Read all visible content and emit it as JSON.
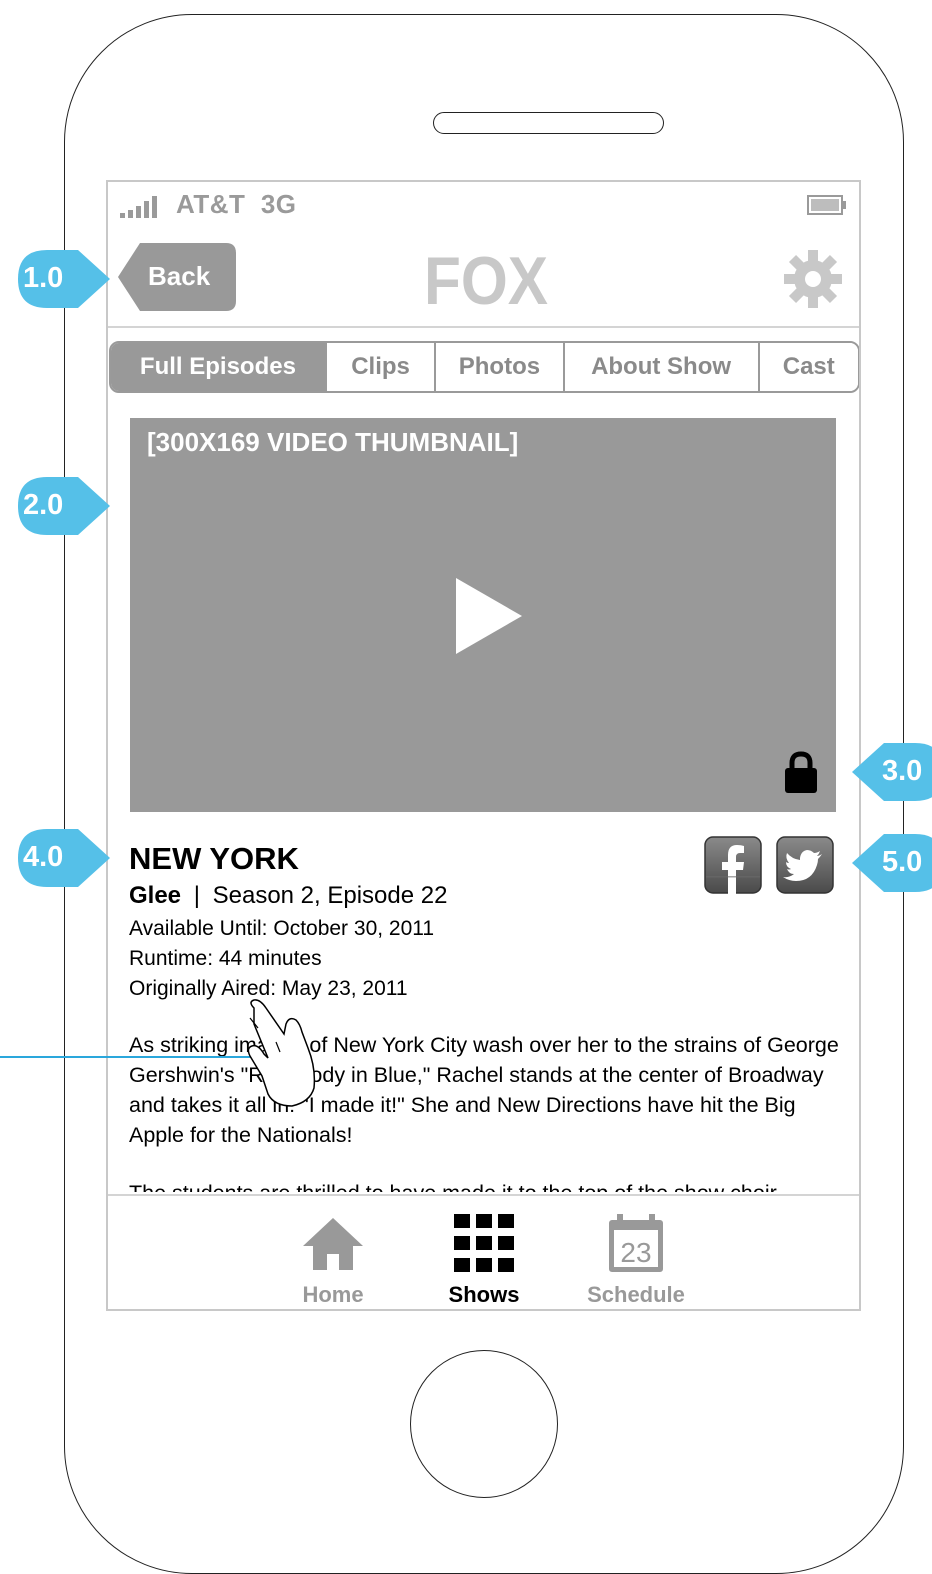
{
  "status_bar": {
    "carrier": "AT&T",
    "network": "3G"
  },
  "nav": {
    "back_label": "Back",
    "logo_text": "FOX"
  },
  "tabs": [
    {
      "label": "Full Episodes",
      "active": true
    },
    {
      "label": "Clips",
      "active": false
    },
    {
      "label": "Photos",
      "active": false
    },
    {
      "label": "About Show",
      "active": false
    },
    {
      "label": "Cast",
      "active": false
    }
  ],
  "video": {
    "placeholder": "[300X169 VIDEO THUMBNAIL]"
  },
  "episode": {
    "title": "NEW YORK",
    "show": "Glee",
    "separator": "|",
    "season_episode": "Season 2, Episode 22",
    "available_until": "Available Until: October 30, 2011",
    "runtime": "Runtime: 44 minutes",
    "originally_aired": "Originally Aired: May 23, 2011",
    "description": [
      "As striking images of New York City wash over her to the strains of George Gershwin's \"Rhapsody in Blue,\" Rachel stands at the center of Broadway and takes it all in: \"I made it!\" She and New Directions have hit the Big Apple for the Nationals!",
      "The students are thrilled to have made it to the top of the show choir"
    ]
  },
  "social": {
    "facebook": "facebook-icon",
    "twitter": "twitter-icon"
  },
  "tabbar": [
    {
      "label": "Home",
      "icon": "home-icon",
      "active": false
    },
    {
      "label": "Shows",
      "icon": "grid-icon",
      "active": true
    },
    {
      "label": "Schedule",
      "icon": "calendar-icon",
      "active": false,
      "badge": "23"
    }
  ],
  "annotations": [
    "1.0",
    "2.0",
    "3.0",
    "4.0",
    "5.0"
  ],
  "colors": {
    "annotation": "#55c0e8",
    "connector": "#2aa7dc",
    "accent_gray": "#999999"
  }
}
